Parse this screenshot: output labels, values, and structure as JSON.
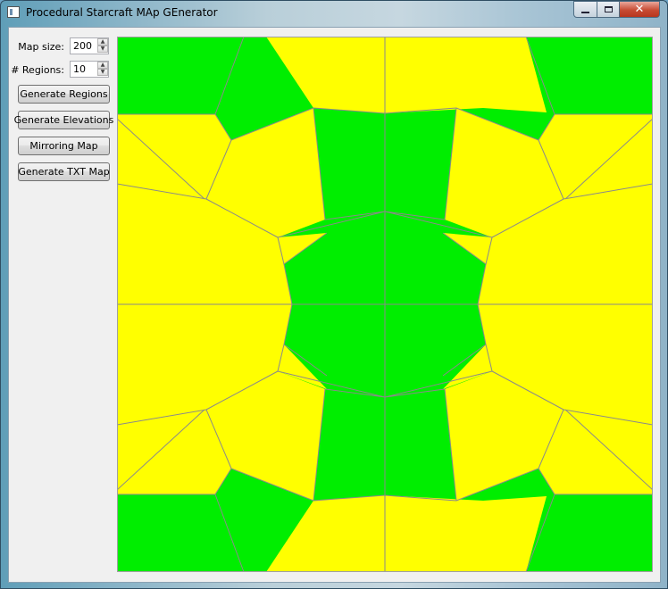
{
  "window": {
    "title": "Procedural Starcraft MAp GEnerator"
  },
  "controls": {
    "map_size": {
      "label": "Map size:",
      "value": "200"
    },
    "regions": {
      "label": "# Regions:",
      "value": "10"
    }
  },
  "buttons": {
    "generate_regions": "Generate Regions",
    "generate_elevations": "Generate Elevations",
    "mirroring_map": "Mirroring Map",
    "generate_txt_map": "Generate TXT Map"
  },
  "colors": {
    "low_ground": "#00ee00",
    "high_ground": "#ffff00",
    "borders": "#8a8a8a"
  },
  "icons": {
    "spin_up": "▲",
    "spin_down": "▼",
    "close": "✕"
  }
}
